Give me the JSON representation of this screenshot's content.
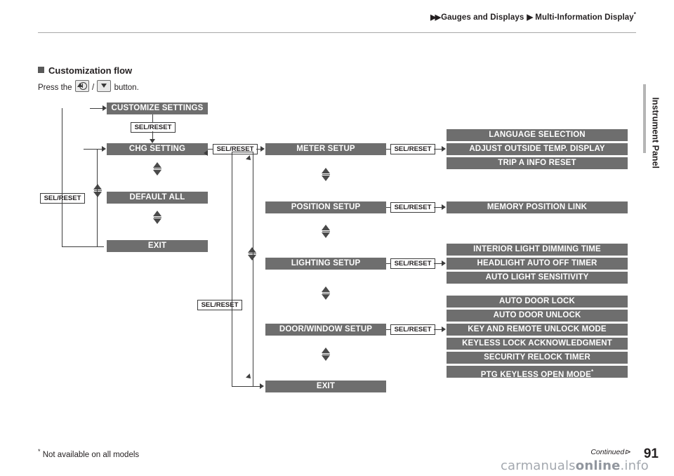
{
  "header": {
    "crumb1": "Gauges and Displays",
    "crumb2": "Multi-Information Display",
    "star": "*",
    "arrows": "▶▶",
    "sep": "▶"
  },
  "side_label": "Instrument Panel",
  "section": {
    "title": "Customization flow",
    "press_prefix": "Press the",
    "press_slash": "/",
    "press_suffix": "button."
  },
  "flow": {
    "sel_reset": "SEL/RESET",
    "boxes": {
      "customize_settings": "CUSTOMIZE SETTINGS",
      "chg_setting": "CHG SETTING",
      "default_all": "DEFAULT ALL",
      "exit_left": "EXIT",
      "meter_setup": "METER SETUP",
      "position_setup": "POSITION SETUP",
      "lighting_setup": "LIGHTING SETUP",
      "door_window_setup": "DOOR/WINDOW SETUP",
      "exit_mid": "EXIT",
      "language_selection": "LANGUAGE SELECTION",
      "adjust_outside_temp": "ADJUST OUTSIDE TEMP. DISPLAY",
      "trip_a_info_reset": "TRIP A INFO RESET",
      "memory_position_link": "MEMORY POSITION LINK",
      "interior_light_dimming": "INTERIOR LIGHT DIMMING TIME",
      "headlight_auto_off": "HEADLIGHT AUTO OFF TIMER",
      "auto_light_sensitivity": "AUTO LIGHT SENSITIVITY",
      "auto_door_lock": "AUTO DOOR LOCK",
      "auto_door_unlock": "AUTO DOOR UNLOCK",
      "key_remote_unlock": "KEY AND REMOTE UNLOCK MODE",
      "keyless_lock_ack": "KEYLESS LOCK ACKNOWLEDGMENT",
      "security_relock_timer": "SECURITY RELOCK TIMER",
      "ptg_keyless_open": "PTG KEYLESS OPEN MODE",
      "ptg_star": "*"
    }
  },
  "footer": {
    "note": "Not available on all models",
    "note_star": "*",
    "continued": "Continued",
    "page": "91",
    "watermark_a": "carmanuals",
    "watermark_b": "online",
    "watermark_c": ".info"
  }
}
